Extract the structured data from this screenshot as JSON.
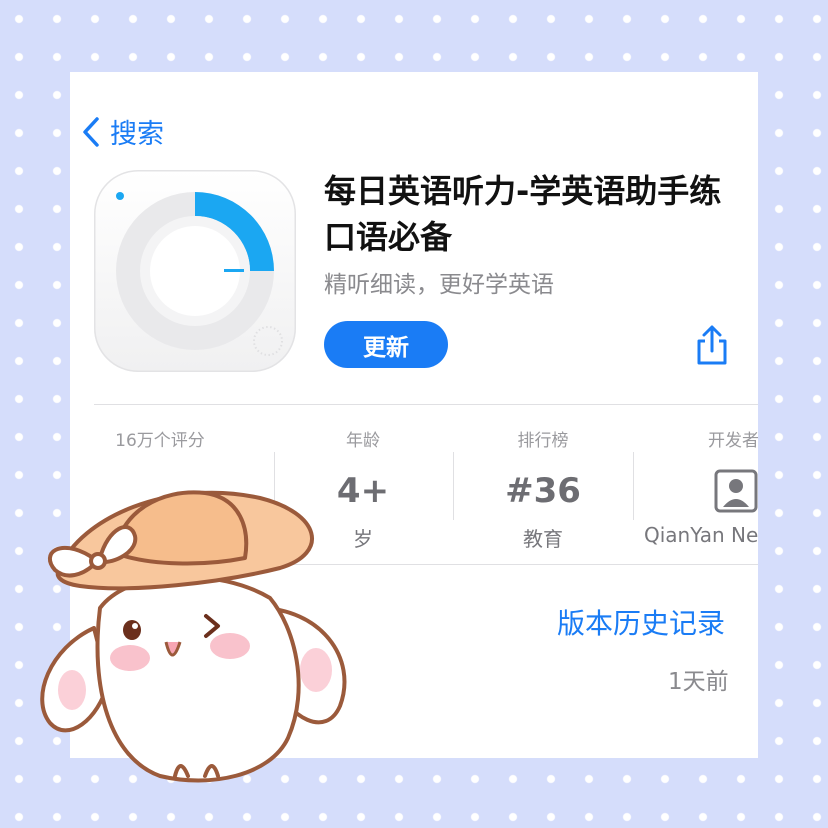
{
  "nav": {
    "back_label": "搜索"
  },
  "app": {
    "title": "每日英语听力-学英语助手练口语必备",
    "subtitle": "精听细读，更好学英语",
    "update_label": "更新",
    "icons": {
      "app": "dial-progress-icon",
      "share": "share-icon",
      "back": "chevron-left-icon"
    }
  },
  "stats": [
    {
      "label": "16万个评分",
      "value": "",
      "sub": ""
    },
    {
      "label": "年龄",
      "value": "4+",
      "sub": "岁"
    },
    {
      "label": "排行榜",
      "value": "#36",
      "sub": "教育"
    },
    {
      "label": "开发者",
      "value": "",
      "sub": "QianYan Ne",
      "icon": "developer-person-icon"
    }
  ],
  "history": {
    "label": "版本历史记录",
    "time": "1天前"
  },
  "colors": {
    "accent": "#1a7cf5",
    "background": "#d5ddfb",
    "dial_progress": "#1ba7f2"
  }
}
